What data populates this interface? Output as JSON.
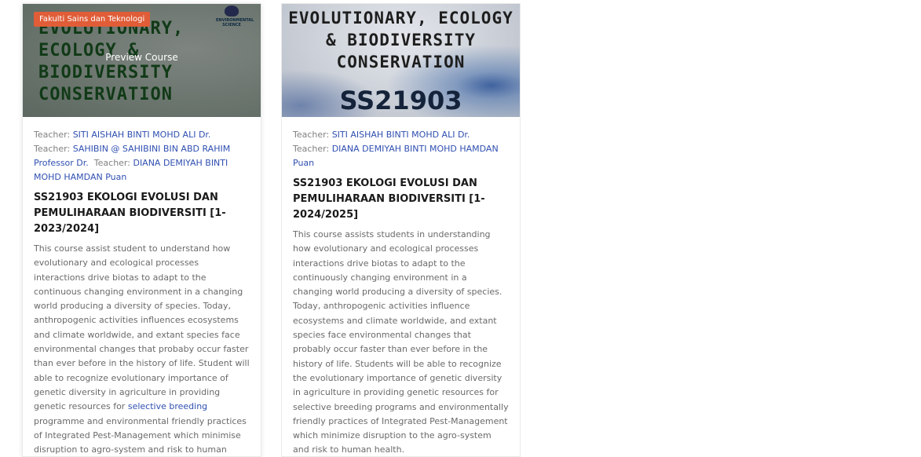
{
  "courses": [
    {
      "category": "Fakulti Sains dan Teknologi",
      "preview_label": "Preview Course",
      "cover_lines": "EVOLUTIONARY,\nECOLOGY &\nBIODIVERSITY\nCONSERVATION",
      "teacher_label": "Teacher:",
      "teachers": [
        "SITI AISHAH BINTI MOHD ALI Dr.",
        "SAHIBIN @ SAHIBINI BIN ABD RAHIM Professor Dr.",
        "DIANA DEMIYAH BINTI MOHD HAMDAN Puan"
      ],
      "title": "SS21903 EKOLOGI EVOLUSI DAN PEMULIHARAAN BIODIVERSITI [1-2023/2024]",
      "description_before": "This course assist student to understand how evolutionary and ecological processes interactions drive biotas to adapt to the continuous changing environment in a changing world producing a diversity of species. Today, anthropogenic activities influences ecosystems and climate worldwide, and extant species face environmental changes that probaby occur faster than ever before in the history of life. Student will able to recognize evolutionary importance of genetic diversity in agriculture in providing genetic resources for ",
      "description_link": "selective breeding",
      "description_after": " programme and environmental friendly practices of Integrated Pest-Management which minimise disruption to agro-system and risk to human health."
    },
    {
      "cover_lines": "EVOLUTIONARY, ECOLOGY\n& BIODIVERSITY\nCONSERVATION",
      "cover_code": "SS21903",
      "teacher_label": "Teacher:",
      "teachers": [
        "SITI AISHAH BINTI MOHD ALI Dr.",
        "DIANA DEMIYAH BINTI MOHD HAMDAN Puan"
      ],
      "title": "SS21903 EKOLOGI EVOLUSI DAN PEMULIHARAAN BIODIVERSITI [1-2024/2025]",
      "description": "This course assists students in understanding how evolutionary and ecological processes interactions drive biotas to adapt to the continuously changing environment in a changing world producing a diversity of species. Today, anthropogenic activities influence ecosystems and climate worldwide, and extant species face environmental changes that probably occur faster than ever before in the history of life. Students will be able to recognize the evolutionary importance of genetic diversity in agriculture in providing genetic resources for selective breeding programs and environmentally friendly practices of Integrated Pest-Management which minimize disruption to the agro-system and risk to human health."
    }
  ],
  "colors": {
    "badge": "#e05d38",
    "link": "#2f4fb0",
    "title": "#1a1a1a",
    "text": "#6a6a6a"
  }
}
